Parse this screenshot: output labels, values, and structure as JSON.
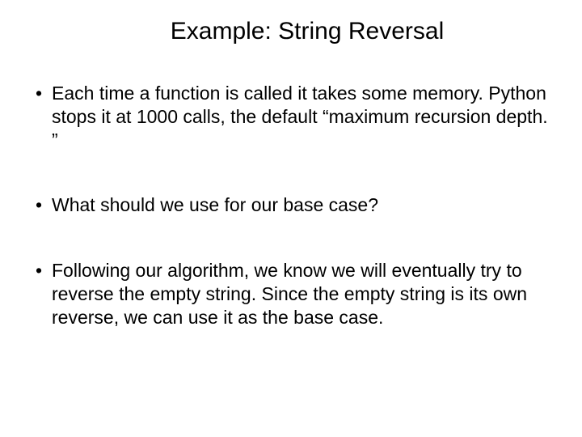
{
  "slide": {
    "title": "Example: String Reversal",
    "bullets": [
      "Each time a function is called it takes some memory. Python stops it at 1000 calls, the default “maximum recursion depth. ”",
      "What should we use for our base case?",
      "Following our algorithm, we know we will eventually try to reverse the empty string. Since the empty string is its own reverse, we can use it as the base case."
    ]
  }
}
